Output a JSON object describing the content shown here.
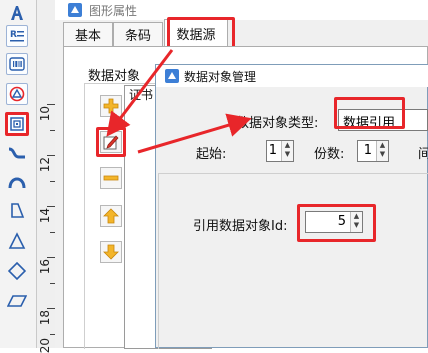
{
  "colors": {
    "accent_red": "#e8262a",
    "tool_border": "#9db3d6",
    "window_bg": "#f0f0f0"
  },
  "toolbar": {
    "tools": [
      {
        "icon": "text-tool-icon"
      },
      {
        "icon": "rich-text-tool-icon"
      },
      {
        "icon": "barcode-tool-icon"
      },
      {
        "icon": "qrcode-tool-icon"
      },
      {
        "icon": "datamatrix-tool-icon"
      },
      {
        "icon": "curve-tool-icon"
      },
      {
        "icon": "arc-tool-icon"
      },
      {
        "icon": "polygon-tool-icon"
      },
      {
        "icon": "triangle-tool-icon"
      },
      {
        "icon": "diamond-tool-icon"
      },
      {
        "icon": "parallelogram-tool-icon"
      }
    ]
  },
  "ruler": {
    "labels": [
      "10",
      "12",
      "14",
      "16",
      "18",
      "20"
    ]
  },
  "property_window": {
    "title": "图形属性",
    "tabs": [
      {
        "label": "基本"
      },
      {
        "label": "条码"
      },
      {
        "label": "数据源",
        "active": true
      }
    ],
    "data_objects_label": "数据对象",
    "list_header": "证书"
  },
  "dialog": {
    "title": "数据对象管理",
    "type_label": "数据对象类型:",
    "type_value": "数据引用",
    "start_label": "起始:",
    "start_value": "1",
    "copies_label": "份数:",
    "copies_value": "1",
    "interval_label": "间",
    "ref_id_label": "引用数据对象Id:",
    "ref_id_value": "5"
  }
}
